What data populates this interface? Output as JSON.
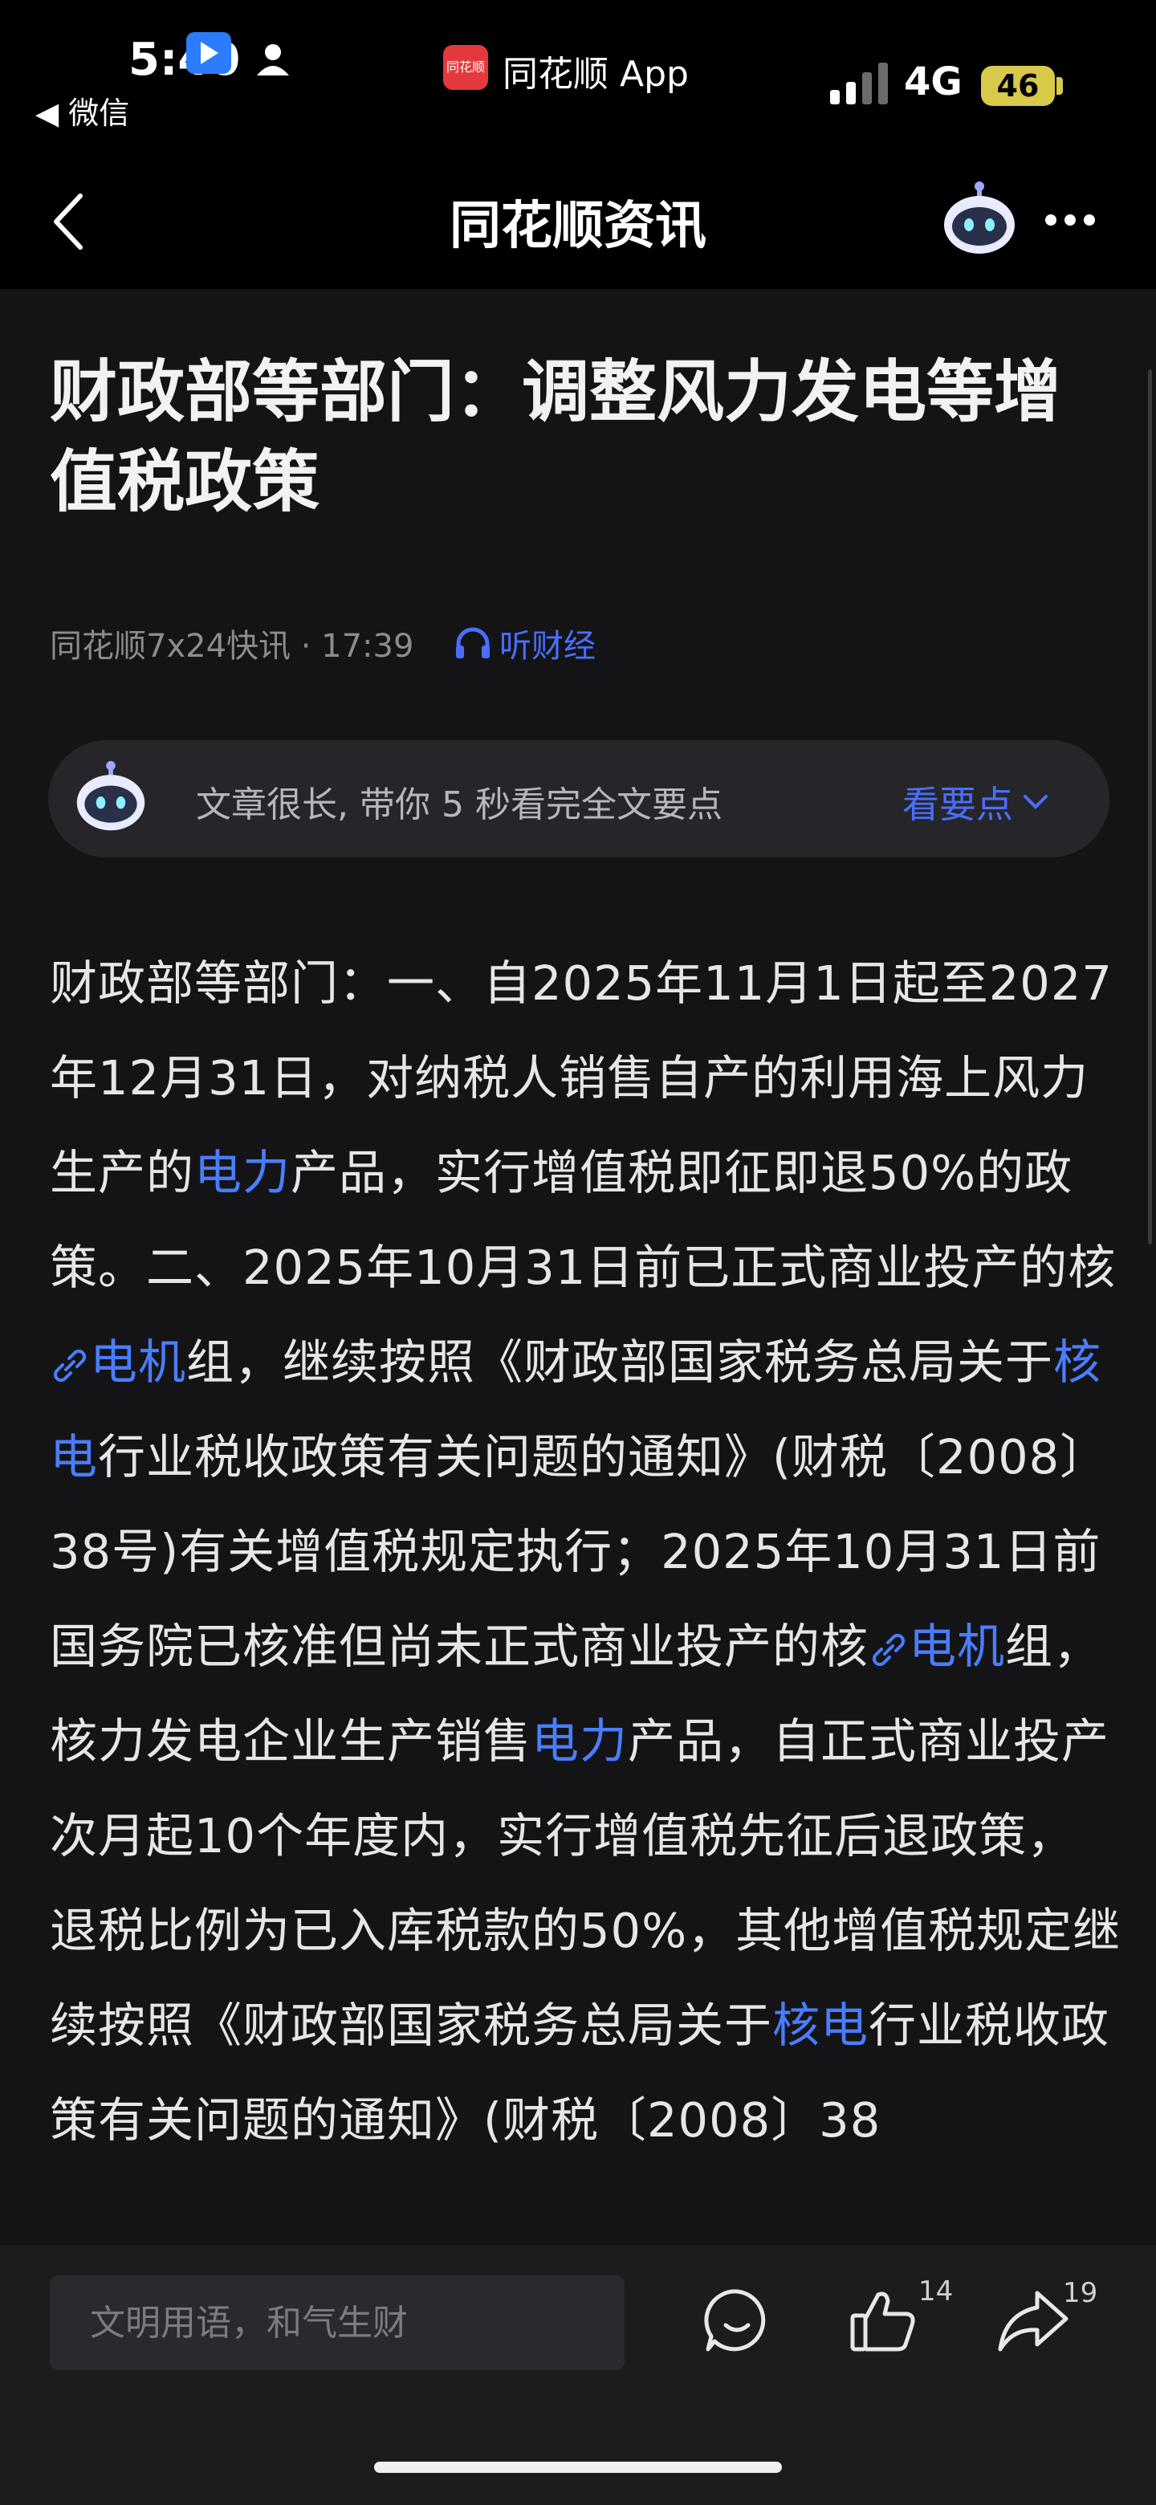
{
  "status_bar": {
    "time": "5:40",
    "back_app_label": "◀ 微信",
    "app_name": "同花顺 App",
    "app_logo_text": "同花顺",
    "network": "4G",
    "battery": "46"
  },
  "nav": {
    "title": "同花顺资讯"
  },
  "article": {
    "title": "财政部等部门：调整风力发电等增值税政策",
    "source_time": "同花顺7x24快讯 · 17:39",
    "listen_label": "听财经",
    "summary_text": "文章很长, 带你 5 秒看完全文要点",
    "summary_link": "看要点",
    "body": {
      "p1": "财政部等部门：一、自2025年11月1日起至2027年12月31日，对纳税人销售自产的利用海上风力生产的",
      "kw_power_1": "电力",
      "p2": "产品，实行增值税即征即退50%的政策。二、2025年10月31日前已正式商业投产的核",
      "kw_motor_1": "电机",
      "p3": "组，继续按照《财政部国家税务总局关于",
      "kw_nuclear_1": "核电",
      "p4": "行业税收政策有关问题的通知》(财税〔2008〕38号)有关增值税规定执行；2025年10月31日前国务院已核准但尚未正式商业投产的核",
      "kw_motor_2": "电机",
      "p5": "组，核力发电企业生产销售",
      "kw_power_2": "电力",
      "p6": "产品，自正式商业投产次月起10个年度内，实行增值税先征后退政策，退税比例为已入库税款的50%，其他增值税规定继续按照《财政部国家税务总局关于",
      "kw_nuclear_2": "核电",
      "p7": "行业税收政策有关问题的通知》(财税〔2008〕38"
    }
  },
  "bottom_bar": {
    "comment_placeholder": "文明用语，和气生财",
    "like_count": "14",
    "share_count": "19"
  },
  "colors": {
    "background": "#141416",
    "accent_blue": "#4a7dff",
    "battery_yellow": "#d8c94b",
    "logo_red": "#e4393c"
  }
}
